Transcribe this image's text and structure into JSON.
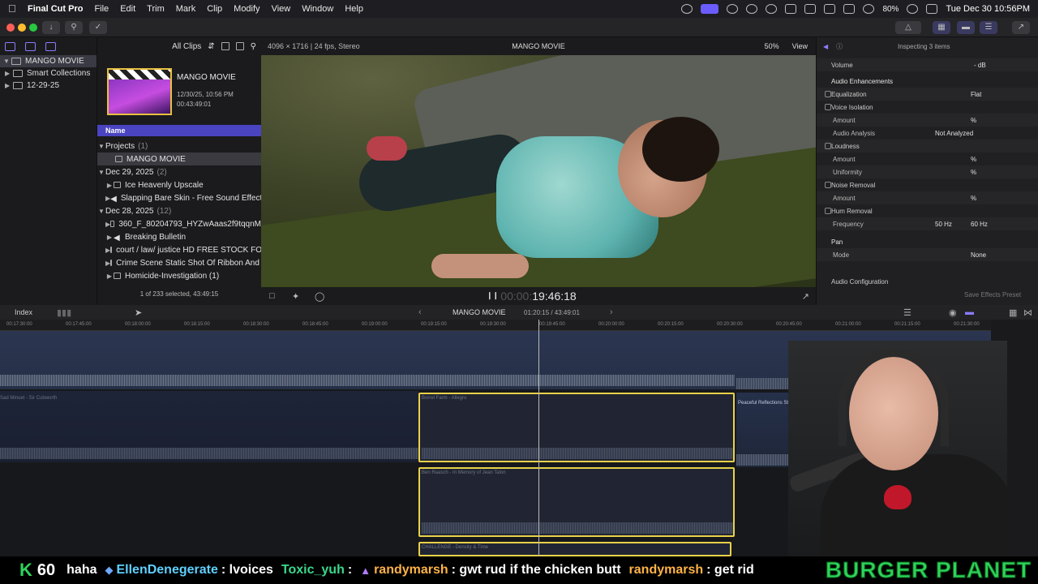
{
  "menubar": {
    "app_name": "Final Cut Pro",
    "items": [
      "File",
      "Edit",
      "Trim",
      "Mark",
      "Clip",
      "Modify",
      "View",
      "Window",
      "Help"
    ],
    "battery": "80%",
    "clock": "Tue Dec 30  10:56PM"
  },
  "libraries": {
    "rows": [
      {
        "label": "MANGO MOVIE",
        "selected": true
      },
      {
        "label": "Smart Collections",
        "selected": false
      },
      {
        "label": "12-29-25",
        "selected": false
      }
    ]
  },
  "browser": {
    "filter_label": "All Clips",
    "clip": {
      "title": "MANGO MOVIE",
      "date": "12/30/25, 10:56 PM",
      "duration": "00:43:49:01"
    },
    "column_header": "Name",
    "rows": [
      {
        "label": "Projects",
        "count": "(1)",
        "kind": "group"
      },
      {
        "label": "MANGO MOVIE",
        "count": "",
        "kind": "project-selected"
      },
      {
        "label": "Dec 29, 2025",
        "count": "(2)",
        "kind": "group"
      },
      {
        "label": "Ice Heavenly Upscale",
        "count": "",
        "kind": "item"
      },
      {
        "label": "Slapping Bare Skin - Free Sound Effects",
        "count": "",
        "kind": "item"
      },
      {
        "label": "Dec 28, 2025",
        "count": "(12)",
        "kind": "group"
      },
      {
        "label": "360_F_80204793_HYZwAaas2f9tqqnM",
        "count": "",
        "kind": "item"
      },
      {
        "label": "Breaking Bulletin",
        "count": "",
        "kind": "item"
      },
      {
        "label": "court / law/ justice HD FREE STOCK FOO",
        "count": "",
        "kind": "item"
      },
      {
        "label": "Crime Scene Static Shot Of Ribbon And S",
        "count": "",
        "kind": "item"
      },
      {
        "label": "Homicide-Investigation (1)",
        "count": "",
        "kind": "item"
      }
    ],
    "footer": "1 of 233 selected, 43:49:15"
  },
  "viewer": {
    "format": "4096 × 1716 | 24 fps, Stereo",
    "title": "MANGO MOVIE",
    "zoom": "50%",
    "view_label": "View",
    "timecode": "19:46:18",
    "timecode_prefix": "00:00:"
  },
  "inspector": {
    "header": "Inspecting 3 items",
    "volume_label": "Volume",
    "volume_value": "- dB",
    "rows": [
      {
        "label": "Audio Enhancements",
        "value": "",
        "value2": "",
        "checkbox": false,
        "header": true
      },
      {
        "label": "Equalization",
        "value": "",
        "value2": "Flat",
        "checkbox": true,
        "header": false
      },
      {
        "label": "Voice Isolation",
        "value": "",
        "value2": "",
        "checkbox": true,
        "header": false
      },
      {
        "label": "Amount",
        "value": "",
        "value2": "%",
        "checkbox": false,
        "header": false
      },
      {
        "label": "Audio Analysis",
        "value": "Not Analyzed",
        "value2": "",
        "checkbox": false,
        "header": false
      },
      {
        "label": "Loudness",
        "value": "",
        "value2": "",
        "checkbox": true,
        "header": false
      },
      {
        "label": "Amount",
        "value": "",
        "value2": "%",
        "checkbox": false,
        "header": false
      },
      {
        "label": "Uniformity",
        "value": "",
        "value2": "%",
        "checkbox": false,
        "header": false
      },
      {
        "label": "Noise Removal",
        "value": "",
        "value2": "",
        "checkbox": true,
        "header": false
      },
      {
        "label": "Amount",
        "value": "",
        "value2": "%",
        "checkbox": false,
        "header": false
      },
      {
        "label": "Hum Removal",
        "value": "",
        "value2": "",
        "checkbox": true,
        "header": false
      },
      {
        "label": "Frequency",
        "value": "50 Hz",
        "value2": "60 Hz",
        "checkbox": false,
        "header": false
      },
      {
        "label": "Pan",
        "value": "",
        "value2": "",
        "checkbox": false,
        "header": true
      },
      {
        "label": "Mode",
        "value": "",
        "value2": "None",
        "checkbox": false,
        "header": false
      }
    ],
    "config_label": "Audio Configuration",
    "save_preset": "Save Effects Preset"
  },
  "timeline": {
    "index_label": "Index",
    "project_name": "MANGO MOVIE",
    "duration": "01:20:15 / 43:49:01",
    "ruler_ticks": [
      "00:17:30:00",
      "00:17:45:00",
      "00:18:00:00",
      "00:18:15:00",
      "00:18:30:00",
      "00:18:45:00",
      "00:19:00:00",
      "00:19:15:00",
      "00:19:30:00",
      "00:19:45:00",
      "00:20:00:00",
      "00:20:15:00",
      "00:20:30:00",
      "00:20:45:00",
      "00:21:00:00",
      "00:21:15:00",
      "00:21:30:00"
    ],
    "clip_labels": [
      "Sad Minuet - Sir Cubworth",
      "Borrel Farm - Allegro",
      "Peaceful Reflections Studio - Fragile per",
      "Ben Raasch - In Memory of Jean Talon",
      "CHALLENGE - Density & Time"
    ]
  },
  "chat": {
    "k_count": "60",
    "messages": [
      {
        "user": "",
        "text": "haha",
        "color": "#ffffff"
      },
      {
        "user": "EllenDenegerate",
        "text": ": lvoices",
        "color": "#5fd0ff"
      },
      {
        "user": "Toxic_yuh",
        "text": ":",
        "color": "#3ad98c"
      },
      {
        "user": "randymarsh",
        "text": ": gwt rud if the chicken butt",
        "color": "#ffb347"
      },
      {
        "user": "randymarsh",
        "text": ": get rid",
        "color": "#ffb347"
      }
    ],
    "brand": "BURGER PLANET"
  }
}
